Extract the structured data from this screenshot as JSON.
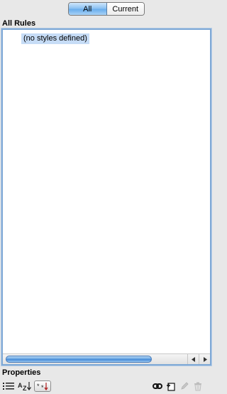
{
  "segmented": {
    "all_label": "All",
    "current_label": "Current",
    "selected": "All"
  },
  "rules": {
    "header": "All Rules",
    "empty_item": "(no styles defined)"
  },
  "properties": {
    "header": "Properties"
  },
  "toolbar": {
    "icons": [
      "list-view-icon",
      "sort-az-icon",
      "show-set-properties-icon",
      "link-icon",
      "add-rule-icon",
      "edit-icon",
      "trash-icon"
    ]
  },
  "colors": {
    "selection": "#c6dcf6",
    "focus_ring": "#7fa9d6",
    "scroll_thumb": "#5f9fe0"
  }
}
